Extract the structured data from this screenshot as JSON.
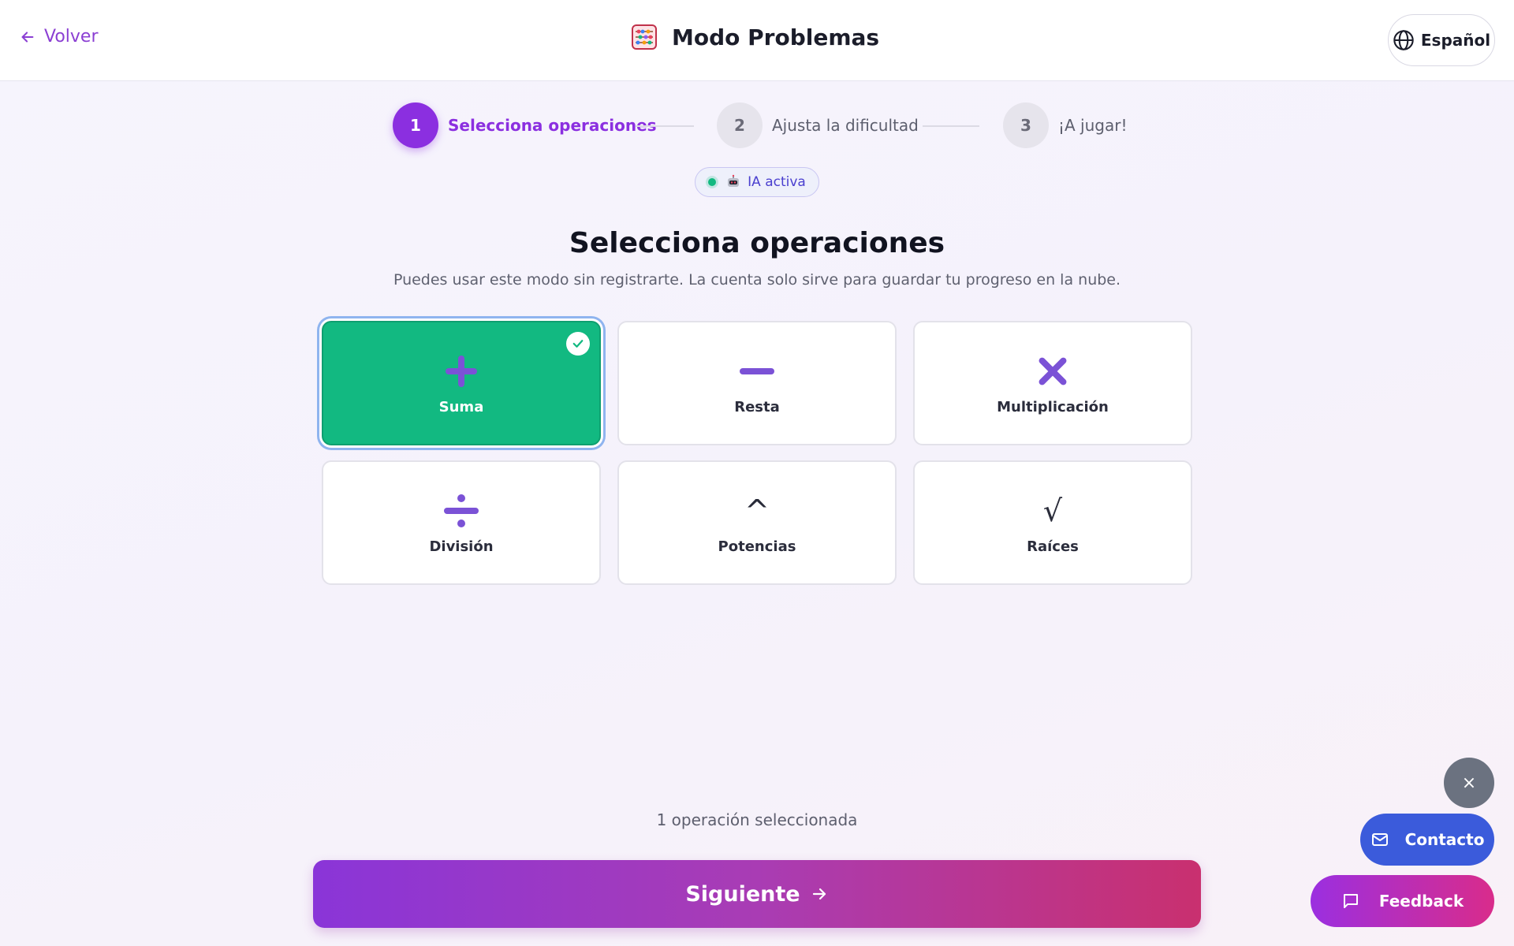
{
  "header": {
    "back_label": "Volver",
    "title": "Modo Problemas",
    "language": "Español"
  },
  "stepper": {
    "steps": [
      {
        "number": "1",
        "label": "Selecciona operaciones",
        "state": "active"
      },
      {
        "number": "2",
        "label": "Ajusta la dificultad",
        "state": "inactive"
      },
      {
        "number": "3",
        "label": "¡A jugar!",
        "state": "inactive"
      }
    ]
  },
  "ai_status": {
    "label": "IA activa",
    "dot_color": "#12b981"
  },
  "main": {
    "heading": "Selecciona operaciones",
    "subheading": "Puedes usar este modo sin registrarte. La cuenta solo sirve para guardar tu progreso en la nube.",
    "operations": [
      {
        "label": "Suma",
        "icon": "plus-icon",
        "selected": true
      },
      {
        "label": "Resta",
        "icon": "minus-icon",
        "selected": false
      },
      {
        "label": "Multiplicación",
        "icon": "times-icon",
        "selected": false
      },
      {
        "label": "División",
        "icon": "divide-icon",
        "selected": false
      },
      {
        "label": "Potencias",
        "glyph": "^",
        "selected": false
      },
      {
        "label": "Raíces",
        "glyph": "√",
        "selected": false
      }
    ],
    "selected_count": "1 operación seleccionada",
    "next_label": "Siguiente"
  },
  "floating": {
    "close_glyph": "×",
    "contact_label": "Contacto",
    "feedback_label": "Feedback"
  },
  "colors": {
    "accent": "#8b2fe0",
    "selected_card": "#12b981",
    "contact": "#3b5bdb",
    "icon_purple": "#7b52d6"
  }
}
